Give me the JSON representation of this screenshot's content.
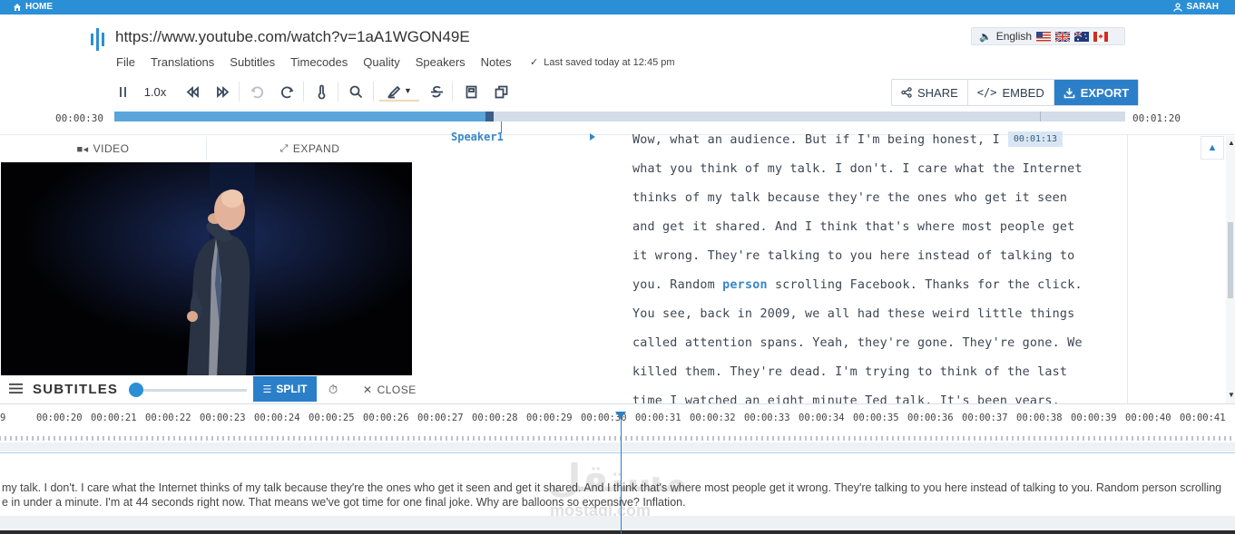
{
  "topbar": {
    "home": "HOME",
    "user": "SARAH"
  },
  "header": {
    "url": "https://www.youtube.com/watch?v=1aA1WGON49E",
    "menu": [
      "File",
      "Translations",
      "Subtitles",
      "Timecodes",
      "Quality",
      "Speakers",
      "Notes"
    ],
    "saved": "Last saved today at 12:45 pm",
    "language": "English"
  },
  "toolbar": {
    "speed": "1.0x",
    "share": "SHARE",
    "embed": "EMBED",
    "export": "EXPORT"
  },
  "progress": {
    "current_time": "00:00:30",
    "end_time": "00:01:20",
    "played_fraction": 0.375
  },
  "video_panel": {
    "video_tab": "VIDEO",
    "expand_tab": "EXPAND"
  },
  "transcript": {
    "speaker": "Speaker1",
    "timestamp_chip": "00:01:13",
    "lines": [
      "Wow, what an audience. But if I'm being honest, I care",
      "what you think of my talk. I don't. I care what the Internet",
      "thinks of my talk because they're the ones who get it seen",
      "and get it shared. And I think that's where most people get",
      "it wrong. They're talking to you here instead of talking to",
      "you. Random",
      "You see, back in 2009, we all had these weird little things",
      "called attention spans. Yeah, they're gone. They're gone. We",
      "killed them. They're dead. I'm trying to think of the last",
      "time I watched an eight minute Ted talk. It's been years,"
    ],
    "keyword": "person",
    "line6_tail": " scrolling Facebook. Thanks for the click."
  },
  "subtitles_bar": {
    "title": "SUBTITLES",
    "split": "SPLIT",
    "close": "CLOSE"
  },
  "timeline": {
    "labels": [
      "9",
      "00:00:20",
      "00:00:21",
      "00:00:22",
      "00:00:23",
      "00:00:24",
      "00:00:25",
      "00:00:26",
      "00:00:27",
      "00:00:28",
      "00:00:29",
      "00:00:30",
      "00:00:31",
      "00:00:32",
      "00:00:33",
      "00:00:34",
      "00:00:35",
      "00:00:36",
      "00:00:37",
      "00:00:38",
      "00:00:39",
      "00:00:40",
      "00:00:41"
    ],
    "subtitle_line1": " my talk. I don't. I care what the Internet thinks of my talk because they're the ones who get it seen and get it shared. And I think that's where most people get it wrong. They're talking to you here instead of talking to you. Random person scrolling",
    "subtitle_line2": "e in under a minute. I'm at 44 seconds right now. That means we've got time for one final joke. Why are balloons so expensive? Inflation."
  },
  "watermark": {
    "arabic": "مستقل",
    "latin": "mostaql.com"
  },
  "colors": {
    "accent": "#2b8fd6",
    "export_bg": "#2b7fc9",
    "keyword": "#3a86c8"
  }
}
